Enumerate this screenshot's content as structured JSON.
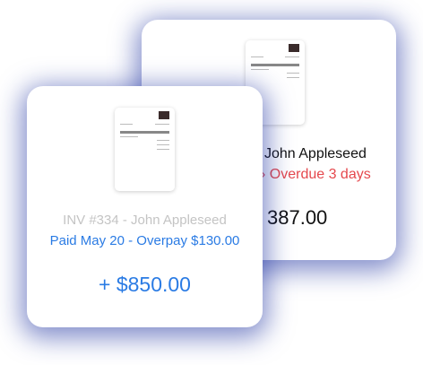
{
  "back_card": {
    "customer": "John Appleseed",
    "status": "› Overdue 3 days",
    "amount": "387.00"
  },
  "front_card": {
    "invoice": "INV #334 - John Appleseed",
    "status": "Paid May 20 - Overpay $130.00",
    "amount": "+ $850.00"
  },
  "colors": {
    "blue": "#2a7be4",
    "red": "#e5484d",
    "gray": "#c4c4c4"
  }
}
